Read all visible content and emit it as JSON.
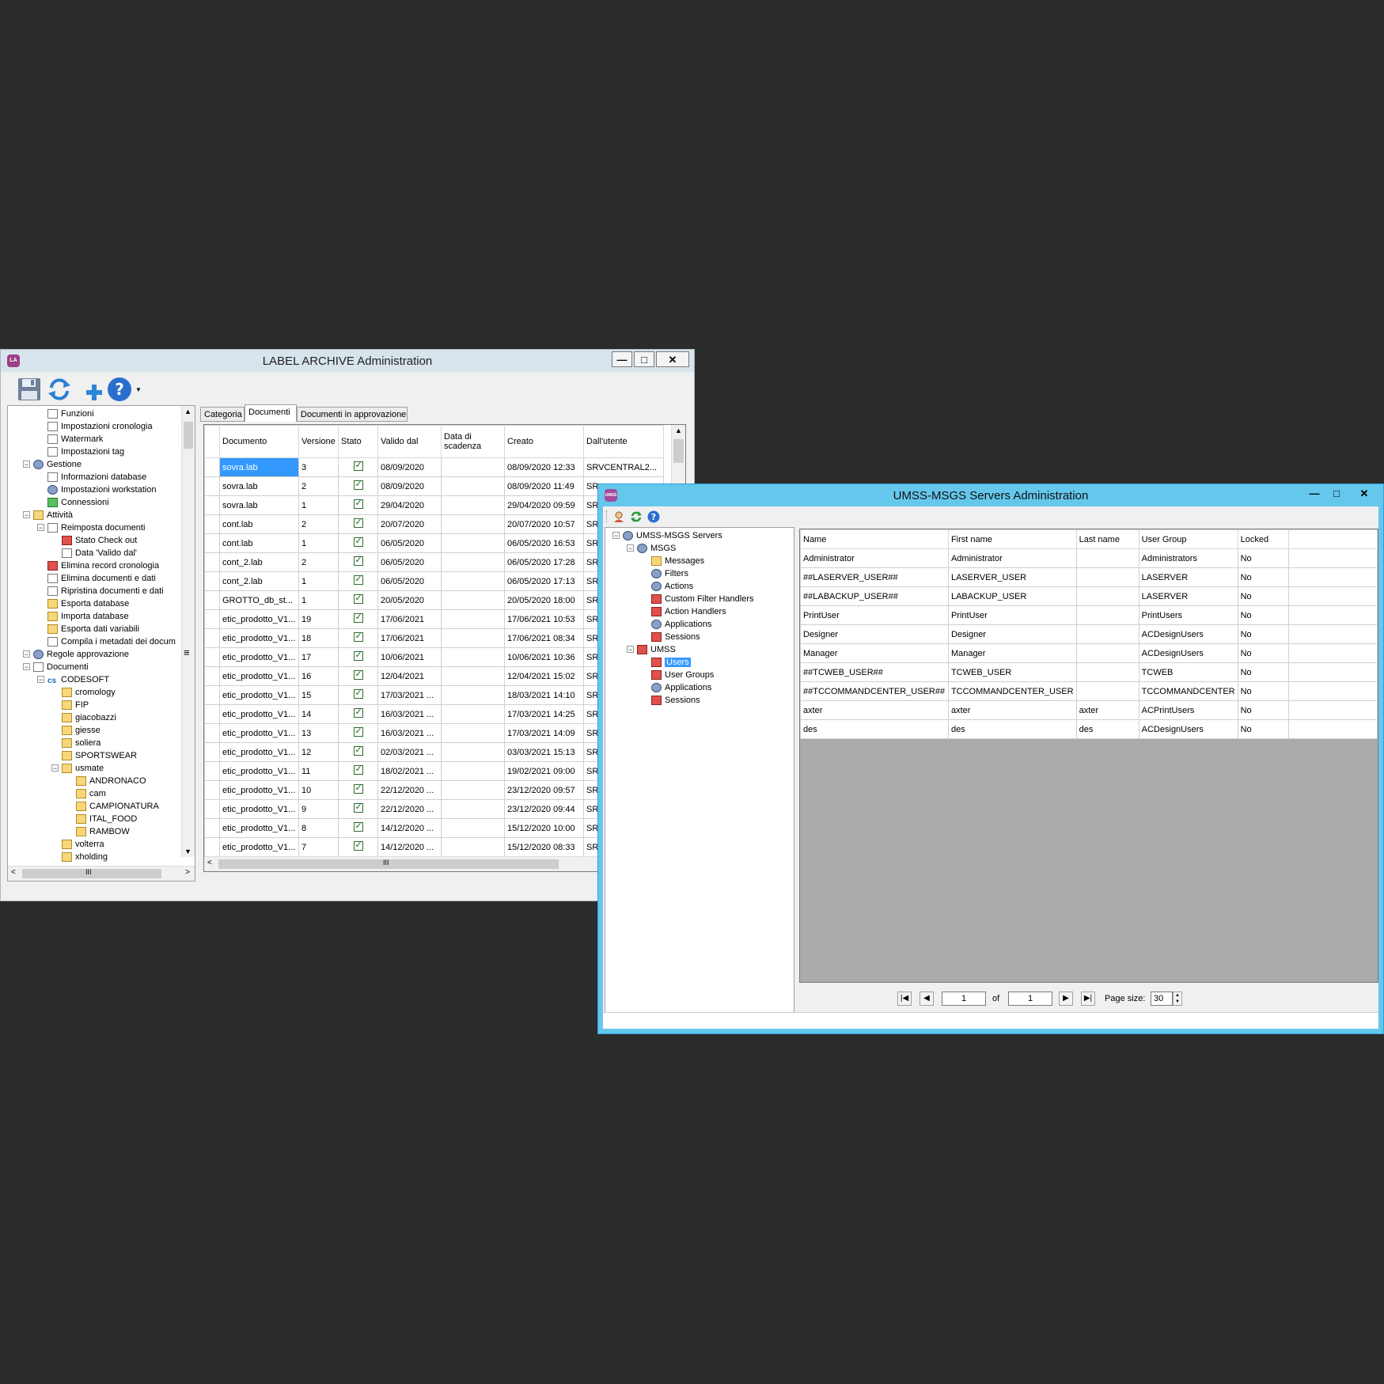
{
  "label_archive": {
    "app_icon_text": "LA",
    "title": "LABEL ARCHIVE Administration",
    "window_controls": {
      "minimize": "—",
      "maximize": "□",
      "close": "✕"
    },
    "toolbar_icons": [
      "save-icon",
      "refresh-icon",
      "add-icon",
      "help-icon"
    ],
    "tree": [
      {
        "label": "Funzioni",
        "icon": "docic",
        "level": 3
      },
      {
        "label": "Impostazioni cronologia",
        "icon": "docic",
        "level": 3
      },
      {
        "label": "Watermark",
        "icon": "docic",
        "level": 3
      },
      {
        "label": "Impostazioni tag",
        "icon": "docic",
        "level": 3
      },
      {
        "label": "Gestione",
        "icon": "gear",
        "level": 2
      },
      {
        "label": "Informazioni database",
        "icon": "docic",
        "level": 3
      },
      {
        "label": "Impostazioni workstation",
        "icon": "gear",
        "level": 3
      },
      {
        "label": "Connessioni",
        "icon": "green",
        "level": 3
      },
      {
        "label": "Attività",
        "icon": "folder",
        "level": 2
      },
      {
        "label": "Reimposta documenti",
        "icon": "docic",
        "level": 3
      },
      {
        "label": "Stato Check out",
        "icon": "red",
        "level": 4
      },
      {
        "label": "Data 'Valido dal'",
        "icon": "docic",
        "level": 4
      },
      {
        "label": "Elimina record cronologia",
        "icon": "red",
        "level": 3
      },
      {
        "label": "Elimina documenti e dati",
        "icon": "docic",
        "level": 3
      },
      {
        "label": "Ripristina documenti e dati",
        "icon": "docic",
        "level": 3
      },
      {
        "label": "Esporta database",
        "icon": "folder",
        "level": 3
      },
      {
        "label": "Importa database",
        "icon": "folder",
        "level": 3
      },
      {
        "label": "Esporta dati variabili",
        "icon": "folder",
        "level": 3
      },
      {
        "label": "Compila i metadati dei docum",
        "icon": "docic",
        "level": 3
      },
      {
        "label": "Regole approvazione",
        "icon": "gear",
        "level": 2
      },
      {
        "label": "Documenti",
        "icon": "docic",
        "level": 2
      },
      {
        "label": "CODESOFT",
        "icon": "cs",
        "level": 3
      },
      {
        "label": "cromology",
        "icon": "folder",
        "level": 4
      },
      {
        "label": "FIP",
        "icon": "folder",
        "level": 4
      },
      {
        "label": "giacobazzi",
        "icon": "folder",
        "level": 4
      },
      {
        "label": "giesse",
        "icon": "folder",
        "level": 4
      },
      {
        "label": "soliera",
        "icon": "folder",
        "level": 4
      },
      {
        "label": "SPORTSWEAR",
        "icon": "folder",
        "level": 4
      },
      {
        "label": "usmate",
        "icon": "folder",
        "level": 4
      },
      {
        "label": "ANDRONACO",
        "icon": "folder",
        "level": 5
      },
      {
        "label": "cam",
        "icon": "folder",
        "level": 5
      },
      {
        "label": "CAMPIONATURA",
        "icon": "folder",
        "level": 5
      },
      {
        "label": "ITAL_FOOD",
        "icon": "folder",
        "level": 5
      },
      {
        "label": "RAMBOW",
        "icon": "folder",
        "level": 5
      },
      {
        "label": "volterra",
        "icon": "folder",
        "level": 4
      },
      {
        "label": "xholding",
        "icon": "folder",
        "level": 4
      }
    ],
    "cs_badge": "cs",
    "tabs": [
      "Categoria",
      "Documenti",
      "Documenti in approvazione"
    ],
    "active_tab": 1,
    "columns": [
      "Documento",
      "Versione",
      "Stato",
      "Valido dal",
      "Data di scadenza",
      "Creato",
      "Dall'utente"
    ],
    "rows": [
      [
        "sovra.lab",
        "3",
        "check",
        "08/09/2020",
        "",
        "08/09/2020 12:33",
        "SRVCENTRAL2..."
      ],
      [
        "sovra.lab",
        "2",
        "check",
        "08/09/2020",
        "",
        "08/09/2020 11:49",
        "SR"
      ],
      [
        "sovra.lab",
        "1",
        "check",
        "29/04/2020",
        "",
        "29/04/2020 09:59",
        "SR"
      ],
      [
        "cont.lab",
        "2",
        "check",
        "20/07/2020",
        "",
        "20/07/2020 10:57",
        "SR"
      ],
      [
        "cont.lab",
        "1",
        "check",
        "06/05/2020",
        "",
        "06/05/2020 16:53",
        "SR"
      ],
      [
        "cont_2.lab",
        "2",
        "check",
        "06/05/2020",
        "",
        "06/05/2020 17:28",
        "SR"
      ],
      [
        "cont_2.lab",
        "1",
        "check",
        "06/05/2020",
        "",
        "06/05/2020 17:13",
        "SR"
      ],
      [
        "GROTTO_db_st...",
        "1",
        "check",
        "20/05/2020",
        "",
        "20/05/2020 18:00",
        "SR"
      ],
      [
        "etic_prodotto_V1...",
        "19",
        "check",
        "17/06/2021",
        "",
        "17/06/2021 10:53",
        "SR"
      ],
      [
        "etic_prodotto_V1...",
        "18",
        "check",
        "17/06/2021",
        "",
        "17/06/2021 08:34",
        "SR"
      ],
      [
        "etic_prodotto_V1...",
        "17",
        "check",
        "10/06/2021",
        "",
        "10/06/2021 10:36",
        "SR"
      ],
      [
        "etic_prodotto_V1...",
        "16",
        "check",
        "12/04/2021",
        "",
        "12/04/2021 15:02",
        "SR"
      ],
      [
        "etic_prodotto_V1...",
        "15",
        "check",
        "17/03/2021 ...",
        "",
        "18/03/2021 14:10",
        "SR"
      ],
      [
        "etic_prodotto_V1...",
        "14",
        "check",
        "16/03/2021 ...",
        "",
        "17/03/2021 14:25",
        "SR"
      ],
      [
        "etic_prodotto_V1...",
        "13",
        "check",
        "16/03/2021 ...",
        "",
        "17/03/2021 14:09",
        "SR"
      ],
      [
        "etic_prodotto_V1...",
        "12",
        "check",
        "02/03/2021 ...",
        "",
        "03/03/2021 15:13",
        "SR"
      ],
      [
        "etic_prodotto_V1...",
        "11",
        "check",
        "18/02/2021 ...",
        "",
        "19/02/2021 09:00",
        "SR"
      ],
      [
        "etic_prodotto_V1...",
        "10",
        "check",
        "22/12/2020 ...",
        "",
        "23/12/2020 09:57",
        "SR"
      ],
      [
        "etic_prodotto_V1...",
        "9",
        "check",
        "22/12/2020 ...",
        "",
        "23/12/2020 09:44",
        "SR"
      ],
      [
        "etic_prodotto_V1...",
        "8",
        "check",
        "14/12/2020 ...",
        "",
        "15/12/2020 10:00",
        "SR"
      ],
      [
        "etic_prodotto_V1...",
        "7",
        "check",
        "14/12/2020 ...",
        "",
        "15/12/2020 08:33",
        "SR"
      ]
    ],
    "scroll_grip": "III",
    "side_grip": "≡"
  },
  "umss": {
    "app_icon_text": "UMSS",
    "title": "UMSS-MSGS Servers Administration",
    "window_controls": {
      "minimize": "—",
      "maximize": "□",
      "close": "✕"
    },
    "toolbar_icons": [
      "user-icon",
      "refresh-icon",
      "help-icon"
    ],
    "tree": [
      {
        "label": "UMSS-MSGS Servers",
        "icon": "gear",
        "level": 0
      },
      {
        "label": "MSGS",
        "icon": "gear",
        "level": 1
      },
      {
        "label": "Messages",
        "icon": "folder",
        "level": 2
      },
      {
        "label": "Filters",
        "icon": "gear",
        "level": 2
      },
      {
        "label": "Actions",
        "icon": "gear",
        "level": 2
      },
      {
        "label": "Custom Filter Handlers",
        "icon": "red",
        "level": 2
      },
      {
        "label": "Action Handlers",
        "icon": "red",
        "level": 2
      },
      {
        "label": "Applications",
        "icon": "gear",
        "level": 2
      },
      {
        "label": "Sessions",
        "icon": "red",
        "level": 2
      },
      {
        "label": "UMSS",
        "icon": "red",
        "level": 1
      },
      {
        "label": "Users",
        "icon": "red",
        "level": 2
      },
      {
        "label": "User Groups",
        "icon": "red",
        "level": 2
      },
      {
        "label": "Applications",
        "icon": "gear",
        "level": 2
      },
      {
        "label": "Sessions",
        "icon": "red",
        "level": 2
      }
    ],
    "selected_tree_index": 10,
    "columns": [
      "Name",
      "First name",
      "Last name",
      "User Group",
      "Locked"
    ],
    "rows": [
      [
        "Administrator",
        "Administrator",
        "",
        "Administrators",
        "No"
      ],
      [
        "##LASERVER_USER##",
        "LASERVER_USER",
        "",
        "LASERVER",
        "No"
      ],
      [
        "##LABACKUP_USER##",
        "LABACKUP_USER",
        "",
        "LASERVER",
        "No"
      ],
      [
        "PrintUser",
        "PrintUser",
        "",
        "PrintUsers",
        "No"
      ],
      [
        "Designer",
        "Designer",
        "",
        "ACDesignUsers",
        "No"
      ],
      [
        "Manager",
        "Manager",
        "",
        "ACDesignUsers",
        "No"
      ],
      [
        "##TCWEB_USER##",
        "TCWEB_USER",
        "",
        "TCWEB",
        "No"
      ],
      [
        "##TCCOMMANDCENTER_USER##",
        "TCCOMMANDCENTER_USER",
        "",
        "TCCOMMANDCENTER",
        "No"
      ],
      [
        "axter",
        "axter",
        "axter",
        "ACPrintUsers",
        "No"
      ],
      [
        "des",
        "des",
        "des",
        "ACDesignUsers",
        "No"
      ]
    ],
    "pager": {
      "first": "|◀",
      "prev": "◀",
      "page": "1",
      "of_label": "of",
      "total": "1",
      "next": "▶",
      "last": "▶|",
      "page_size_label": "Page size:",
      "page_size": "30"
    }
  }
}
